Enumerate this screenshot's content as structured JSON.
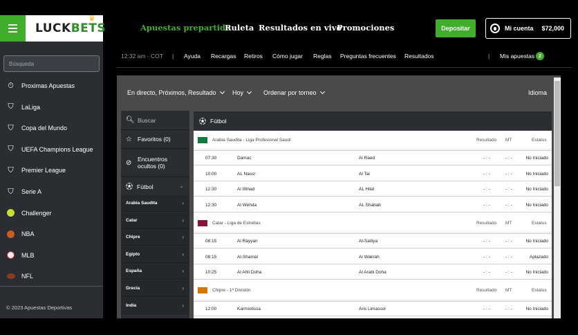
{
  "brand": {
    "name_a": "LUCK",
    "name_b": "BETS"
  },
  "sidebar": {
    "search_placeholder": "Búsqueda",
    "items": [
      {
        "label": "Proximas Apuestas",
        "icon": "stopwatch-icon"
      },
      {
        "label": "LaLiga",
        "icon": "soccer-shield-icon"
      },
      {
        "label": "Copa del Mundo",
        "icon": "soccer-shield-icon"
      },
      {
        "label": "UEFA Champions League",
        "icon": "soccer-shield-icon"
      },
      {
        "label": "Premier League",
        "icon": "soccer-shield-icon"
      },
      {
        "label": "Serie A",
        "icon": "soccer-shield-icon"
      },
      {
        "label": "Challenger",
        "icon": "tennis-ball-icon"
      },
      {
        "label": "NBA",
        "icon": "basketball-icon"
      },
      {
        "label": "MLB",
        "icon": "baseball-icon"
      },
      {
        "label": "NFL",
        "icon": "football-icon"
      }
    ],
    "copyright": "© 2023 Apuestas Deportivas"
  },
  "topnav": {
    "items": [
      "Apuestas prepartido",
      "Ruleta",
      "Resultados en vivo",
      "Promociones"
    ],
    "active": "Apuestas prepartido",
    "deposit_label": "Depositar",
    "account_label": "Mi cuenta",
    "balance": "$72,000"
  },
  "secondary": {
    "time": "12:32 am - COT",
    "links": [
      "Ayuda",
      "Recargas",
      "Retiros",
      "Cómo jugar",
      "Reglas",
      "Preguntas frecuentes",
      "Resultados"
    ],
    "my_bets_label": "Mis apuestas",
    "my_bets_count": "2"
  },
  "filters": {
    "view": "En directo, Próximos, Resultado",
    "day": "Hoy",
    "order": "Ordenar por torneo",
    "language": "Idioma"
  },
  "leftcol": {
    "search": "Buscar",
    "favorites": "Favoritos (0)",
    "hidden_a": "Encuentros",
    "hidden_b": "ocultos (0)",
    "sport": "Fútbol",
    "countries": [
      "Arabia Saudita",
      "Catar",
      "Chipre",
      "Egipto",
      "España",
      "Grecia",
      "India"
    ]
  },
  "board": {
    "sport_title": "Fútbol",
    "col_result": "Resultado",
    "col_mt": "MT",
    "col_status": "Estatus",
    "leagues": [
      {
        "name": "Arabia Saudita - Liga Profesional Saudí",
        "flag": "#0f7a3c",
        "matches": [
          {
            "time": "07:30",
            "home": "Damac",
            "away": "Al Raed",
            "result": "- : -",
            "mt": "- : -",
            "status": "No Iniciado"
          },
          {
            "time": "10:00",
            "home": "AL Nassr",
            "away": "Al Tai",
            "result": "- : -",
            "mt": "- : -",
            "status": "No Iniciado"
          },
          {
            "time": "12:30",
            "home": "Al Ittihad",
            "away": "AL Hilal",
            "result": "- : -",
            "mt": "- : -",
            "status": "No Iniciado"
          },
          {
            "time": "12:30",
            "home": "Al Wehda",
            "away": "AL Shabab",
            "result": "- : -",
            "mt": "- : -",
            "status": "No Iniciado"
          }
        ]
      },
      {
        "name": "Catar - Liga de Estrellas",
        "flag": "#8a1538",
        "matches": [
          {
            "time": "08:15",
            "home": "Al Rayyan",
            "away": "Al-Sailiya",
            "result": "- : -",
            "mt": "- : -",
            "status": "No Iniciado"
          },
          {
            "time": "08:15",
            "home": "Al-Shamal",
            "away": "Al Wakrah",
            "result": "- : -",
            "mt": "- : -",
            "status": "Aplazado"
          },
          {
            "time": "10:25",
            "home": "Al Ahli Doha",
            "away": "Al Arabi Doha",
            "result": "- : -",
            "mt": "- : -",
            "status": "No Iniciado"
          }
        ]
      },
      {
        "name": "Chipre - 1ª División",
        "flag": "#d57800",
        "matches": [
          {
            "time": "12:00",
            "home": "Karmiotissa",
            "away": "Aris Limassol",
            "result": "- : -",
            "mt": "- : -",
            "status": "No Iniciado"
          }
        ]
      }
    ]
  }
}
